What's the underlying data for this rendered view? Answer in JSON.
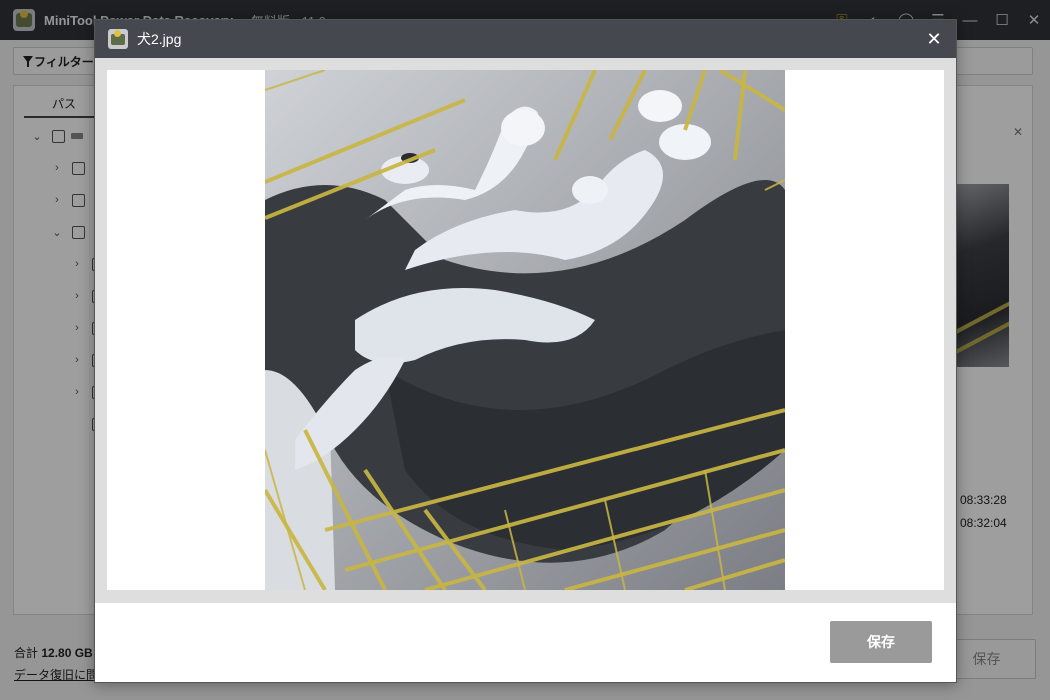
{
  "app": {
    "title": "MiniTool Power Data Recovery",
    "edition": "無料版 - 11.9",
    "window_icons": [
      "key-icon",
      "theme-icon",
      "help-icon",
      "menu-icon",
      "minimize-icon",
      "maximize-icon",
      "close-icon"
    ]
  },
  "toolbar": {
    "filter_label": "フィルター"
  },
  "panel": {
    "tab_path": "パス",
    "times": [
      "08:33:28",
      "08:32:04"
    ]
  },
  "status": {
    "total_prefix": "合計",
    "total_size": "12.80 GB",
    "help_link": "データ復旧に問題",
    "save_label": "保存"
  },
  "modal": {
    "title": "犬2.jpg",
    "close_glyph": "✕",
    "save_label": "保存",
    "image_subject": "black-and-white dog sleeping on its back inside a yellow wire crate"
  },
  "colors": {
    "titlebar": "#2f3238",
    "modal_header": "#464850",
    "save_button": "#9a9a9a",
    "crate_yellow": "#c9b643",
    "fur_dark": "#3a3d42",
    "fur_light": "#e8ecf2"
  }
}
